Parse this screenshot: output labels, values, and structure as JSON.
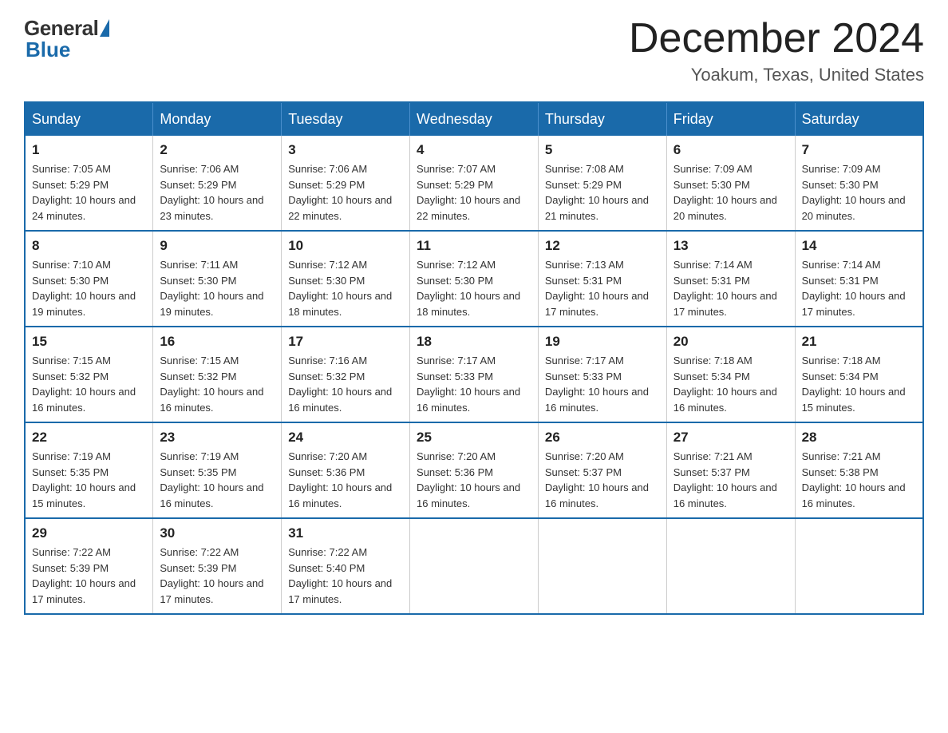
{
  "logo": {
    "general": "General",
    "blue": "Blue"
  },
  "title": {
    "month_year": "December 2024",
    "location": "Yoakum, Texas, United States"
  },
  "days_of_week": [
    "Sunday",
    "Monday",
    "Tuesday",
    "Wednesday",
    "Thursday",
    "Friday",
    "Saturday"
  ],
  "weeks": [
    [
      {
        "day": "1",
        "sunrise": "Sunrise: 7:05 AM",
        "sunset": "Sunset: 5:29 PM",
        "daylight": "Daylight: 10 hours and 24 minutes."
      },
      {
        "day": "2",
        "sunrise": "Sunrise: 7:06 AM",
        "sunset": "Sunset: 5:29 PM",
        "daylight": "Daylight: 10 hours and 23 minutes."
      },
      {
        "day": "3",
        "sunrise": "Sunrise: 7:06 AM",
        "sunset": "Sunset: 5:29 PM",
        "daylight": "Daylight: 10 hours and 22 minutes."
      },
      {
        "day": "4",
        "sunrise": "Sunrise: 7:07 AM",
        "sunset": "Sunset: 5:29 PM",
        "daylight": "Daylight: 10 hours and 22 minutes."
      },
      {
        "day": "5",
        "sunrise": "Sunrise: 7:08 AM",
        "sunset": "Sunset: 5:29 PM",
        "daylight": "Daylight: 10 hours and 21 minutes."
      },
      {
        "day": "6",
        "sunrise": "Sunrise: 7:09 AM",
        "sunset": "Sunset: 5:30 PM",
        "daylight": "Daylight: 10 hours and 20 minutes."
      },
      {
        "day": "7",
        "sunrise": "Sunrise: 7:09 AM",
        "sunset": "Sunset: 5:30 PM",
        "daylight": "Daylight: 10 hours and 20 minutes."
      }
    ],
    [
      {
        "day": "8",
        "sunrise": "Sunrise: 7:10 AM",
        "sunset": "Sunset: 5:30 PM",
        "daylight": "Daylight: 10 hours and 19 minutes."
      },
      {
        "day": "9",
        "sunrise": "Sunrise: 7:11 AM",
        "sunset": "Sunset: 5:30 PM",
        "daylight": "Daylight: 10 hours and 19 minutes."
      },
      {
        "day": "10",
        "sunrise": "Sunrise: 7:12 AM",
        "sunset": "Sunset: 5:30 PM",
        "daylight": "Daylight: 10 hours and 18 minutes."
      },
      {
        "day": "11",
        "sunrise": "Sunrise: 7:12 AM",
        "sunset": "Sunset: 5:30 PM",
        "daylight": "Daylight: 10 hours and 18 minutes."
      },
      {
        "day": "12",
        "sunrise": "Sunrise: 7:13 AM",
        "sunset": "Sunset: 5:31 PM",
        "daylight": "Daylight: 10 hours and 17 minutes."
      },
      {
        "day": "13",
        "sunrise": "Sunrise: 7:14 AM",
        "sunset": "Sunset: 5:31 PM",
        "daylight": "Daylight: 10 hours and 17 minutes."
      },
      {
        "day": "14",
        "sunrise": "Sunrise: 7:14 AM",
        "sunset": "Sunset: 5:31 PM",
        "daylight": "Daylight: 10 hours and 17 minutes."
      }
    ],
    [
      {
        "day": "15",
        "sunrise": "Sunrise: 7:15 AM",
        "sunset": "Sunset: 5:32 PM",
        "daylight": "Daylight: 10 hours and 16 minutes."
      },
      {
        "day": "16",
        "sunrise": "Sunrise: 7:15 AM",
        "sunset": "Sunset: 5:32 PM",
        "daylight": "Daylight: 10 hours and 16 minutes."
      },
      {
        "day": "17",
        "sunrise": "Sunrise: 7:16 AM",
        "sunset": "Sunset: 5:32 PM",
        "daylight": "Daylight: 10 hours and 16 minutes."
      },
      {
        "day": "18",
        "sunrise": "Sunrise: 7:17 AM",
        "sunset": "Sunset: 5:33 PM",
        "daylight": "Daylight: 10 hours and 16 minutes."
      },
      {
        "day": "19",
        "sunrise": "Sunrise: 7:17 AM",
        "sunset": "Sunset: 5:33 PM",
        "daylight": "Daylight: 10 hours and 16 minutes."
      },
      {
        "day": "20",
        "sunrise": "Sunrise: 7:18 AM",
        "sunset": "Sunset: 5:34 PM",
        "daylight": "Daylight: 10 hours and 16 minutes."
      },
      {
        "day": "21",
        "sunrise": "Sunrise: 7:18 AM",
        "sunset": "Sunset: 5:34 PM",
        "daylight": "Daylight: 10 hours and 15 minutes."
      }
    ],
    [
      {
        "day": "22",
        "sunrise": "Sunrise: 7:19 AM",
        "sunset": "Sunset: 5:35 PM",
        "daylight": "Daylight: 10 hours and 15 minutes."
      },
      {
        "day": "23",
        "sunrise": "Sunrise: 7:19 AM",
        "sunset": "Sunset: 5:35 PM",
        "daylight": "Daylight: 10 hours and 16 minutes."
      },
      {
        "day": "24",
        "sunrise": "Sunrise: 7:20 AM",
        "sunset": "Sunset: 5:36 PM",
        "daylight": "Daylight: 10 hours and 16 minutes."
      },
      {
        "day": "25",
        "sunrise": "Sunrise: 7:20 AM",
        "sunset": "Sunset: 5:36 PM",
        "daylight": "Daylight: 10 hours and 16 minutes."
      },
      {
        "day": "26",
        "sunrise": "Sunrise: 7:20 AM",
        "sunset": "Sunset: 5:37 PM",
        "daylight": "Daylight: 10 hours and 16 minutes."
      },
      {
        "day": "27",
        "sunrise": "Sunrise: 7:21 AM",
        "sunset": "Sunset: 5:37 PM",
        "daylight": "Daylight: 10 hours and 16 minutes."
      },
      {
        "day": "28",
        "sunrise": "Sunrise: 7:21 AM",
        "sunset": "Sunset: 5:38 PM",
        "daylight": "Daylight: 10 hours and 16 minutes."
      }
    ],
    [
      {
        "day": "29",
        "sunrise": "Sunrise: 7:22 AM",
        "sunset": "Sunset: 5:39 PM",
        "daylight": "Daylight: 10 hours and 17 minutes."
      },
      {
        "day": "30",
        "sunrise": "Sunrise: 7:22 AM",
        "sunset": "Sunset: 5:39 PM",
        "daylight": "Daylight: 10 hours and 17 minutes."
      },
      {
        "day": "31",
        "sunrise": "Sunrise: 7:22 AM",
        "sunset": "Sunset: 5:40 PM",
        "daylight": "Daylight: 10 hours and 17 minutes."
      },
      null,
      null,
      null,
      null
    ]
  ]
}
